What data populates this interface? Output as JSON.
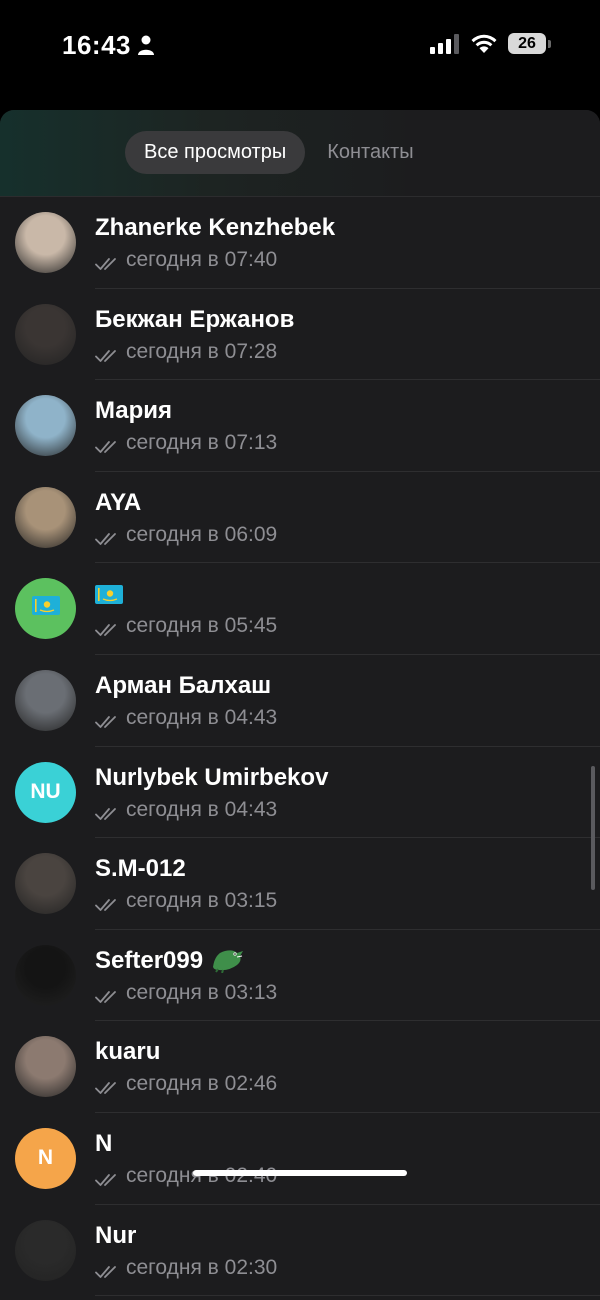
{
  "status_bar": {
    "time": "16:43",
    "battery": "26"
  },
  "tabs": [
    {
      "label": "Все просмотры",
      "active": true
    },
    {
      "label": "Контакты",
      "active": false
    }
  ],
  "viewers": [
    {
      "name": "Zhanerke Kenzhebek",
      "time": "сегодня в 07:40",
      "avatar": "photo",
      "avatar_color": "#c9b8a8"
    },
    {
      "name": "Бекжан Ержанов",
      "time": "сегодня в 07:28",
      "avatar": "photo",
      "avatar_color": "#3a3533"
    },
    {
      "name": "Мария",
      "time": "сегодня в 07:13",
      "avatar": "photo",
      "avatar_color": "#8fb3c9"
    },
    {
      "name": "AYA",
      "time": "сегодня в 06:09",
      "avatar": "photo",
      "avatar_color": "#a89278"
    },
    {
      "name": "",
      "name_emoji": "flag-kazakhstan-icon",
      "time": "сегодня в 05:45",
      "avatar": "flag",
      "avatar_color": "#5cc15f"
    },
    {
      "name": "Арман Балхаш",
      "time": "сегодня в 04:43",
      "avatar": "photo",
      "avatar_color": "#6a6e74"
    },
    {
      "name": "Nurlybek Umirbekov",
      "time": "сегодня в 04:43",
      "avatar": "initials",
      "initials": "NU",
      "avatar_color": "#3ad1d6"
    },
    {
      "name": "S.M-012",
      "time": "сегодня в 03:15",
      "avatar": "photo",
      "avatar_color": "#4a4440"
    },
    {
      "name": "Sefter099",
      "name_emoji": "crocodile-icon",
      "time": "сегодня в 03:13",
      "avatar": "photo",
      "avatar_color": "#141414"
    },
    {
      "name": "kuaru",
      "time": "сегодня в 02:46",
      "avatar": "photo",
      "avatar_color": "#8c7a70"
    },
    {
      "name": "N",
      "time": "сегодня в 02:40",
      "avatar": "initials",
      "initials": "N",
      "avatar_color": "#f5a54a"
    },
    {
      "name": "Nur",
      "time": "сегодня в 02:30",
      "avatar": "photo",
      "avatar_color": "#2a2a2a"
    }
  ],
  "colors": {
    "background": "#000000",
    "sheet": "#1c1c1e",
    "active_tab": "#3a3a3c",
    "secondary_text": "#8e8e93"
  }
}
